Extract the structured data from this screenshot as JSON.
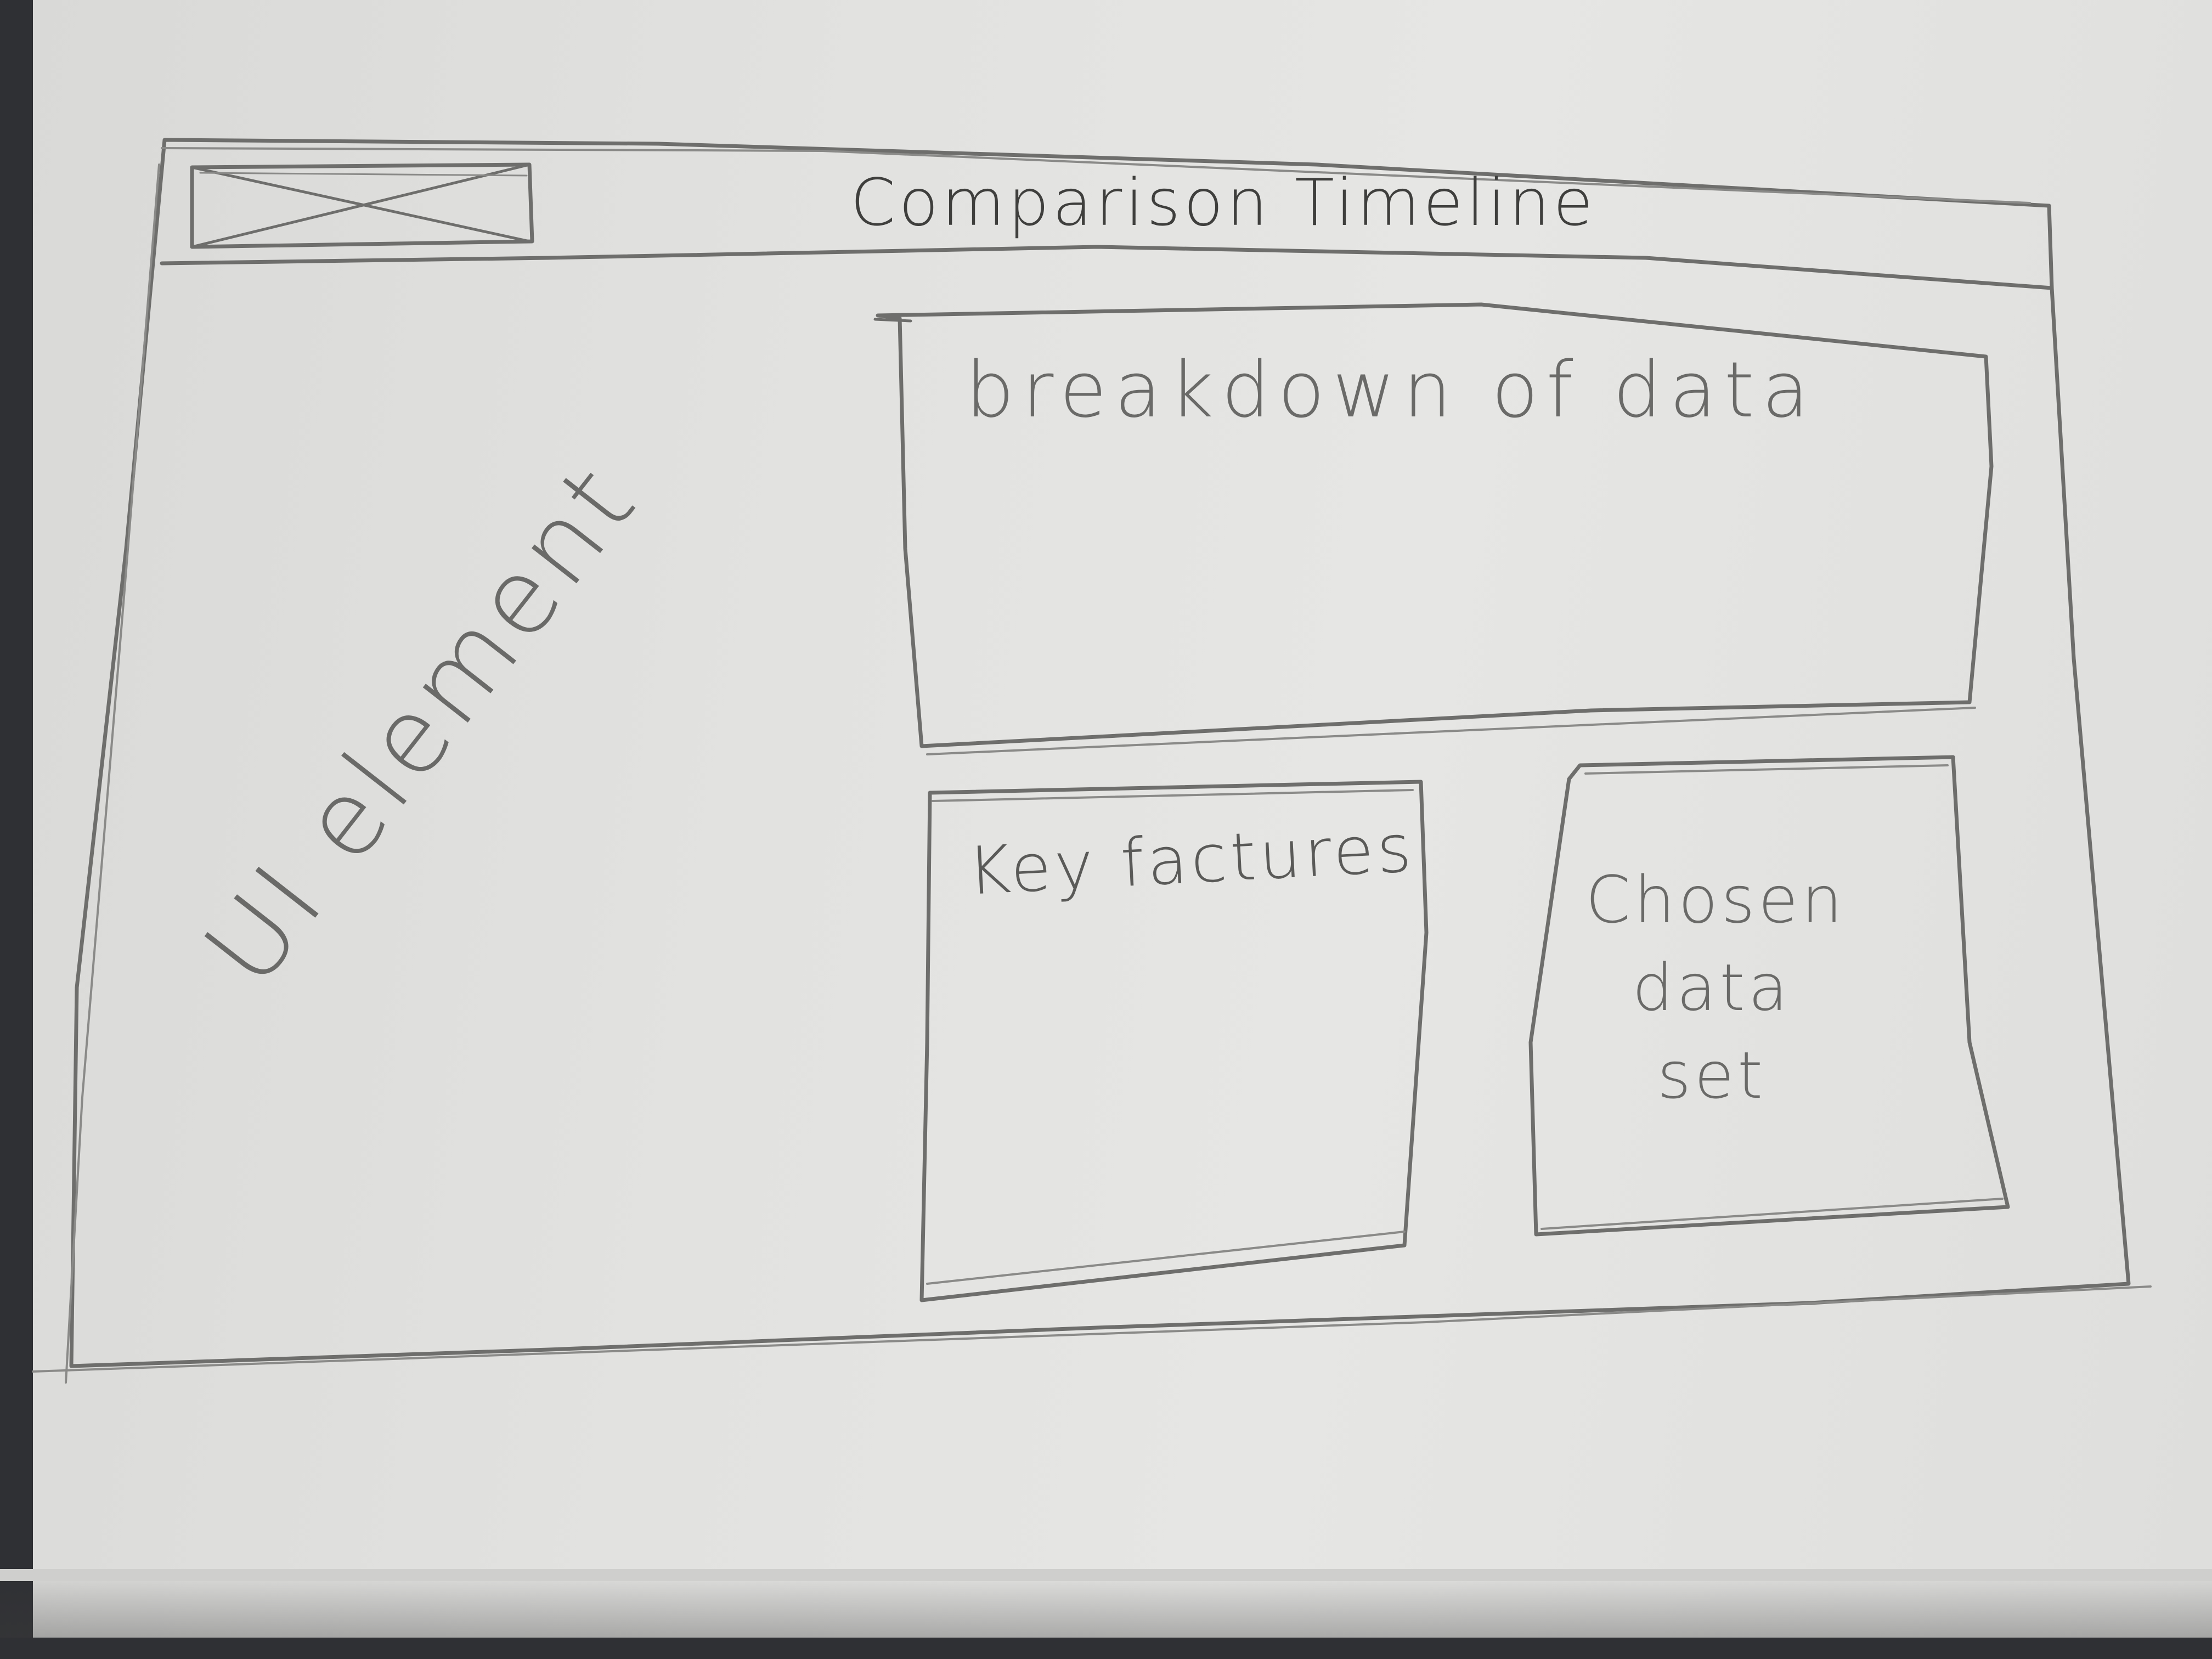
{
  "window": {
    "title": "Comparison Timeline"
  },
  "logo": {
    "icon": "image-placeholder-icon"
  },
  "left_panel": {
    "label": "UI element"
  },
  "panels": {
    "breakdown": "breakdown of data",
    "key_features": "Key factures",
    "chosen_data_set": "Chosen\ndata\nset"
  },
  "colors": {
    "paper": "#e2e2e0",
    "pencil": "#5a5a58"
  }
}
